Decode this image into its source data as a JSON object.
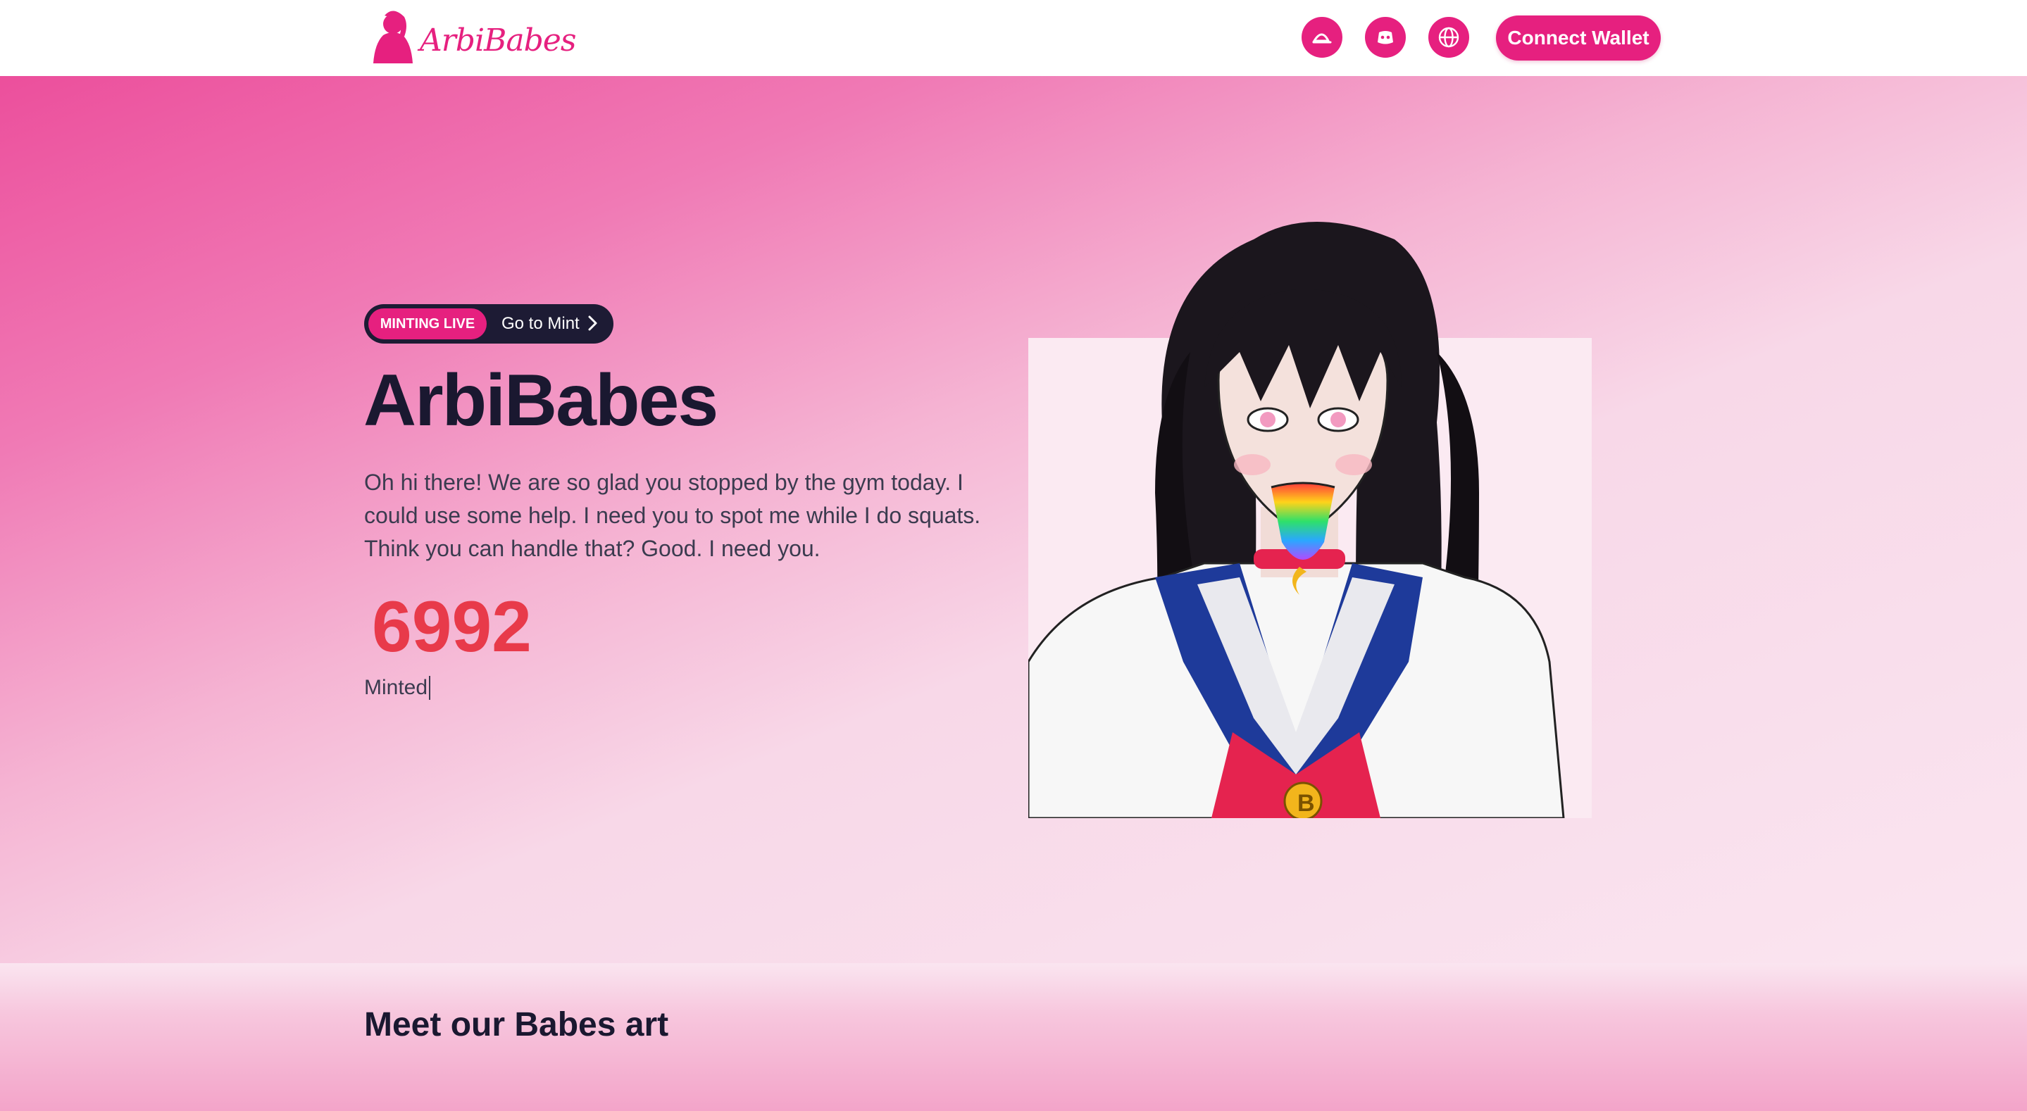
{
  "brand": {
    "name": "ArbiBabes",
    "primary_color": "#e6207f",
    "dark_color": "#1d1b34"
  },
  "nav": {
    "icons": [
      "opensea-icon",
      "discord-icon",
      "globe-icon"
    ],
    "connect_label": "Connect Wallet"
  },
  "hero": {
    "badge": "MINTING LIVE",
    "badge_link": "Go to Mint",
    "title": "ArbiBabes",
    "description": "Oh hi there! We are so glad you stopped by the gym today. I could use some help. I need you to spot me while I do squats. Think you can handle that? Good. I need you.",
    "minted_count": "6992",
    "minted_label": "Minted",
    "count_color": "#e83a4a"
  },
  "section": {
    "title": "Meet our Babes art"
  }
}
